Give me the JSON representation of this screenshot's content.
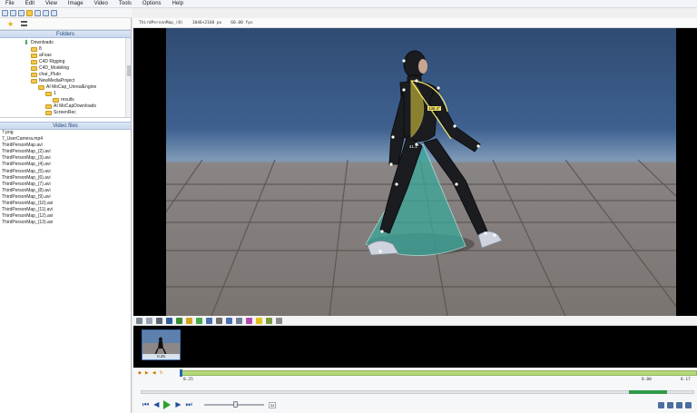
{
  "menu": [
    "File",
    "Edit",
    "View",
    "Image",
    "Video",
    "Tools",
    "Options",
    "Help"
  ],
  "help_glyph": "?",
  "left_panel": {
    "folders_title": "Folders",
    "tree": [
      {
        "label": "Downloads",
        "indent": 3,
        "icon": "download-icon"
      },
      {
        "label": "8",
        "indent": 4,
        "icon": "folder-icon"
      },
      {
        "label": "aFxas",
        "indent": 4,
        "icon": "folder-icon"
      },
      {
        "label": "C4D Rigging",
        "indent": 4,
        "icon": "folder-icon"
      },
      {
        "label": "C4D_Modeling",
        "indent": 4,
        "icon": "folder-icon"
      },
      {
        "label": "char_Pluto",
        "indent": 4,
        "icon": "folder-icon"
      },
      {
        "label": "NewMediaProject",
        "indent": 4,
        "icon": "folder-icon"
      },
      {
        "label": "AI MoCap_UnrealEngine",
        "indent": 5,
        "icon": "folder-icon"
      },
      {
        "label": "1",
        "indent": 6,
        "icon": "folder-icon"
      },
      {
        "label": "results",
        "indent": 7,
        "icon": "folder-icon"
      },
      {
        "label": "AI MoCapDownloads",
        "indent": 5,
        "icon": "folder-icon"
      },
      {
        "label": "ScreenRec",
        "indent": 5,
        "icon": "folder-icon"
      }
    ],
    "video_files_title": "Video files",
    "files": [
      "7.png",
      "7_UserCamera.mp4",
      "ThirdPersonMap.avi",
      "ThirdPersonMap_(2).avi",
      "ThirdPersonMap_(3).avi",
      "ThirdPersonMap_(4).avi",
      "ThirdPersonMap_(5).avi",
      "ThirdPersonMap_(6).avi",
      "ThirdPersonMap_(7).avi",
      "ThirdPersonMap_(8).avi",
      "ThirdPersonMap_(9).avi",
      "ThirdPersonMap_(10).avi",
      "ThirdPersonMap_(11).avi",
      "ThirdPersonMap_(12).avi",
      "ThirdPersonMap_(13).avi"
    ]
  },
  "viewer_info": {
    "filename": "ThirdPersonMap_(8)",
    "resolution": "1046×2160 px",
    "fps": "60.00 fps"
  },
  "overlay": {
    "upper_angle": "136.4°",
    "lower_angle": "41.1°"
  },
  "thumbnail": {
    "label": "0.25"
  },
  "timeline": {
    "start": "0.25",
    "mid": "8.00",
    "end": "8.17"
  },
  "player": {
    "speed": "1x"
  },
  "colors": {
    "accent_blue": "#2a64b8",
    "timeline_green": "#b4d879",
    "play_green": "#2da12d",
    "overlay_teal": "#3aa89a",
    "overlay_yellow": "#e8d23a"
  }
}
